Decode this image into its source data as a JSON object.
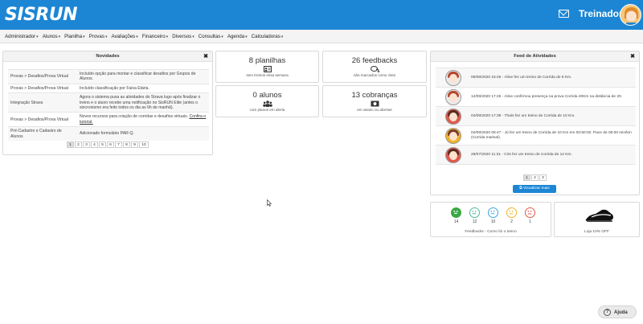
{
  "header": {
    "logo": "SISRUN",
    "user": "Treinador"
  },
  "menu": [
    "Administrador",
    "Alunos",
    "Planilha",
    "Provas",
    "Avaliações",
    "Financeiro",
    "Diversos",
    "Consultas",
    "Agenda",
    "Calculadoras"
  ],
  "news": {
    "title": "Novidades",
    "rows": [
      {
        "category": "Provas > Desafios/Prova Virtual",
        "text": "Incluído opção para montar e classificar desafios por Grupos de Alunos."
      },
      {
        "category": "Provas > Desafios/Prova Virtual",
        "text": "Incluído classificação por Faixa Etária."
      },
      {
        "category": "Integração Strava",
        "text": "Agora o sistema puxa as atividades do Strava logo após finalizar o treino e o aluno recebe uma notificação no SisRUN Elite (antes o sincronismo era feito todos os dia as 6h de manhã)."
      },
      {
        "category": "Provas > Desafios/Prova Virtual",
        "text": "Novos recursos para criação de corridas e desafios virtuais.",
        "link": "Confira o tutorial."
      },
      {
        "category": "Pré-Cadastro e Cadastro de Alunos",
        "text": "Adicionado formulário PAR-Q."
      }
    ],
    "pages": [
      "1",
      "2",
      "3",
      "4",
      "5",
      "6",
      "7",
      "8",
      "9",
      "10"
    ]
  },
  "stats": [
    {
      "value": "8 planilhas",
      "label": "sem treinos essa semana",
      "icon": "id-card-icon"
    },
    {
      "value": "26 feedbacks",
      "label": "não marcados como visto",
      "icon": "chat-icon"
    },
    {
      "value": "0 alunos",
      "label": "com planos em alerta",
      "icon": "users-icon"
    },
    {
      "value": "13 cobranças",
      "label": "em atraso ou abertas",
      "icon": "money-icon"
    }
  ],
  "feed": {
    "title": "Feed de Atividades",
    "items": [
      {
        "time": "06/08/2020 15:46",
        "text": "Aline fez um treino de Corrida de 8 Km."
      },
      {
        "time": "12/08/2020 17:25",
        "text": "Aline confirmou presença na prova Corrida 20Km na distância de 20."
      },
      {
        "time": "04/08/2020 17:39",
        "text": "Thaís fez um treino de Corrida de 10 Km."
      },
      {
        "time": "04/08/2020 08:47",
        "text": "Jú fez um treino de Corrida de 10 Km em 00:50:02. Pace de 05:00 min/km (Corrida matinal)."
      },
      {
        "time": "28/07/2020 11:31",
        "text": "Cris fez um treino de Corrida de 12 Km."
      }
    ],
    "pages": [
      "1",
      "2",
      "3"
    ],
    "more_button": "Visualizar mais"
  },
  "feedback_summary": {
    "counts": [
      "14",
      "12",
      "10",
      "2",
      "1"
    ],
    "colors": [
      "#3aa845",
      "#4fb8a0",
      "#39a7d8",
      "#f0b429",
      "#e3584b"
    ],
    "label": "Feedbacks - Como foi o treino"
  },
  "store": {
    "label": "Loja 10% OFF"
  },
  "help": {
    "label": "Ajuda"
  }
}
